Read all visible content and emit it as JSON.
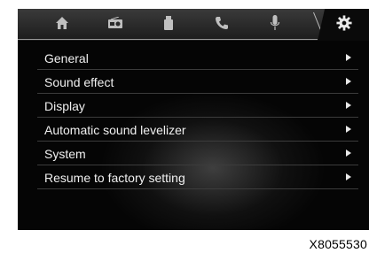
{
  "tabs": [
    {
      "icon": "home-icon"
    },
    {
      "icon": "radio-icon"
    },
    {
      "icon": "usb-media-icon"
    },
    {
      "icon": "phone-icon"
    },
    {
      "icon": "microphone-icon"
    },
    {
      "icon": "settings-gear-icon",
      "active": true
    }
  ],
  "menu": {
    "items": [
      {
        "label": "General"
      },
      {
        "label": "Sound effect"
      },
      {
        "label": "Display"
      },
      {
        "label": "Automatic sound levelizer"
      },
      {
        "label": "System"
      },
      {
        "label": "Resume to factory setting"
      }
    ]
  },
  "figure_code": "X8055530",
  "colors": {
    "screen_bg": "#050505",
    "text": "#f0f0f0",
    "separator": "#3c3c3c"
  }
}
